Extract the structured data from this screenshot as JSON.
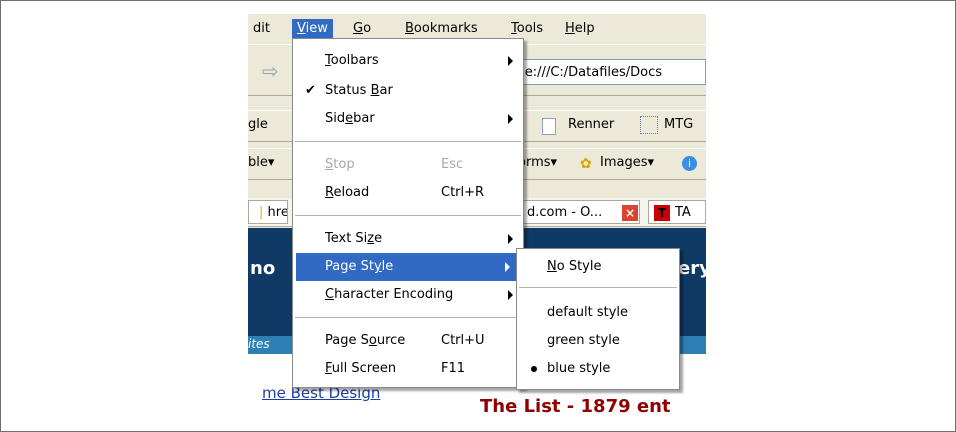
{
  "menubar": {
    "items": [
      "dit",
      "View",
      "Go",
      "Bookmarks",
      "Tools",
      "Help"
    ]
  },
  "navbar": {
    "url": "file:///C:/Datafiles/Docs"
  },
  "bookmarks_bar": {
    "left_fragment": "gle",
    "items": [
      "Renner",
      "MTG"
    ]
  },
  "extension_bar": {
    "left_fragment": "ble▾",
    "items": [
      "orms▾",
      "Images▾"
    ]
  },
  "tabs": {
    "items": [
      "hre",
      "d.com - O...",
      "TA"
    ]
  },
  "page": {
    "dark_fragment_left": "no",
    "dark_fragment_right": "ery",
    "stripe_fragment": "ites",
    "link_text": "me Best Design",
    "title_text": "The List - 1879 ent"
  },
  "view_menu": {
    "toolbars": "Toolbars",
    "status_bar": "Status Bar",
    "sidebar": "Sidebar",
    "stop": "Stop",
    "stop_shortcut": "Esc",
    "reload": "Reload",
    "reload_shortcut": "Ctrl+R",
    "text_size": "Text Size",
    "page_style": "Page Style",
    "character_encoding": "Character Encoding",
    "page_source": "Page Source",
    "page_source_shortcut": "Ctrl+U",
    "full_screen": "Full Screen",
    "full_screen_shortcut": "F11",
    "status_bar_checked": true
  },
  "page_style_submenu": {
    "no_style": "No Style",
    "default_style": "default style",
    "green_style": "green style",
    "blue_style": "blue style",
    "selected": "blue style"
  },
  "colors": {
    "menu_highlight": "#316ac5",
    "page_dark_blue": "#0f3a66",
    "title_red": "#8f0000"
  }
}
